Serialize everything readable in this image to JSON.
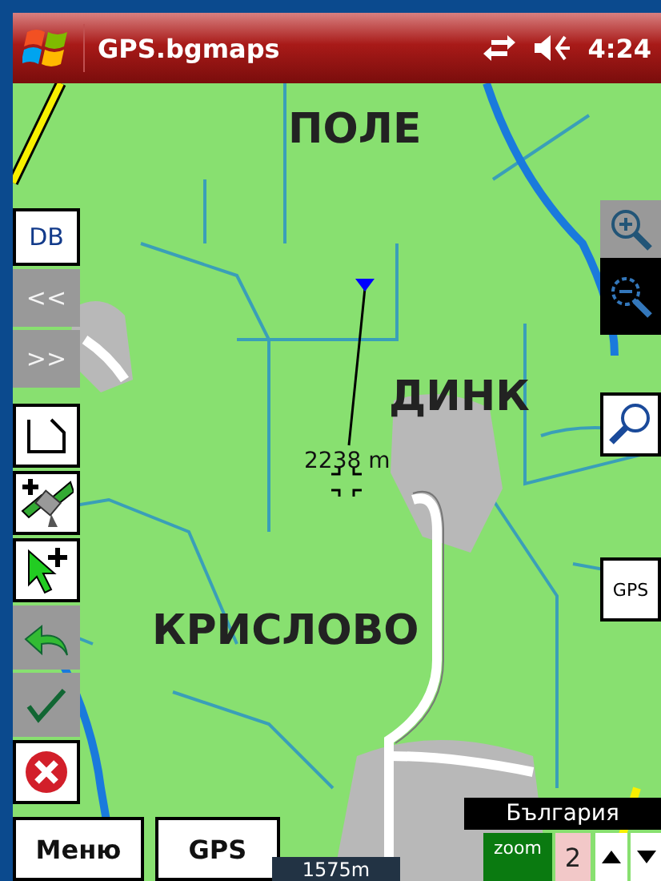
{
  "title_bar": {
    "title": "GPS.bgmaps",
    "time": "4:24"
  },
  "map": {
    "labels": [
      {
        "text": "ПОЛЕ"
      },
      {
        "text": "ДИНК"
      },
      {
        "text": "КРИСЛОВО"
      }
    ],
    "measurement": "2238 m",
    "scale": "1575m",
    "region": "България"
  },
  "left_toolbar": [
    {
      "kind": "text",
      "label": "DB",
      "disabled": false
    },
    {
      "kind": "text",
      "label": "<<",
      "disabled": true
    },
    {
      "kind": "text",
      "label": ">>",
      "disabled": true
    },
    {
      "kind": "polyline",
      "disabled": false
    },
    {
      "kind": "satellite",
      "disabled": false
    },
    {
      "kind": "cursor",
      "disabled": false
    },
    {
      "kind": "undo",
      "disabled": true
    },
    {
      "kind": "check",
      "disabled": true
    },
    {
      "kind": "cancel",
      "disabled": false
    }
  ],
  "right_toolbar": [
    {
      "kind": "zoom-in",
      "selected": false,
      "disabled": true
    },
    {
      "kind": "zoom-out",
      "selected": true,
      "disabled": false
    },
    {
      "kind": "search",
      "selected": false,
      "disabled": false
    },
    {
      "kind": "text",
      "label": "GPS",
      "selected": false,
      "disabled": false
    }
  ],
  "bottom_bar": {
    "menu": "Меню",
    "gps": "GPS"
  },
  "zoom": {
    "label": "zoom",
    "value": "2"
  }
}
